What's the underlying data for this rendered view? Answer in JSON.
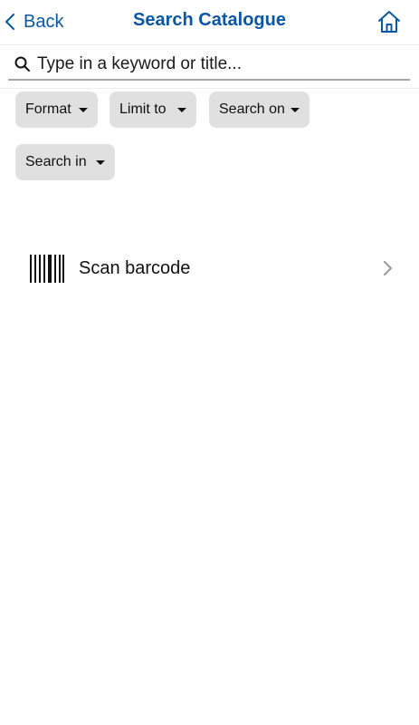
{
  "header": {
    "back_label": "Back",
    "title": "Search Catalogue",
    "icons": {
      "back": "chevron-left-icon",
      "home": "home-icon"
    }
  },
  "search": {
    "placeholder": "Type in a keyword or title...",
    "value": "",
    "icon": "search-icon"
  },
  "filters": [
    {
      "label": "Format"
    },
    {
      "label": "Limit to"
    },
    {
      "label": "Search on"
    },
    {
      "label": "Search in"
    }
  ],
  "scan": {
    "label": "Scan barcode",
    "icon": "barcode-icon"
  },
  "colors": {
    "accent": "#0b57a4",
    "chip_bg": "#e0e0e0",
    "text": "#111111",
    "divider": "#ececec"
  }
}
